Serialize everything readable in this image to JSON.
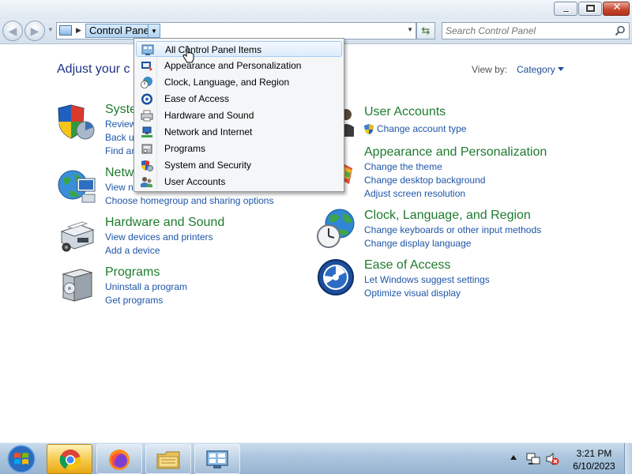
{
  "window": {
    "minimize_icon": "minimize-icon",
    "maximize_icon": "maximize-icon",
    "close_glyph": "✕"
  },
  "address_bar": {
    "breadcrumb": "Control Panel",
    "search_placeholder": "Search Control Panel"
  },
  "main": {
    "heading": "Adjust your c",
    "view_by_label": "View by:",
    "view_by_value": "Category"
  },
  "categories_left": [
    {
      "title": "Syste",
      "links": [
        "Review",
        "Back u",
        "Find an"
      ]
    },
    {
      "title": "Netw",
      "links": [
        "View n",
        "Choose homegroup and sharing options"
      ]
    },
    {
      "title": "Hardware and Sound",
      "links": [
        "View devices and printers",
        "Add a device"
      ]
    },
    {
      "title": "Programs",
      "links": [
        "Uninstall a program",
        "Get programs"
      ]
    }
  ],
  "categories_right": [
    {
      "title": "User Accounts",
      "links": [
        "Change account type"
      ]
    },
    {
      "title": "Appearance and Personalization",
      "links": [
        "Change the theme",
        "Change desktop background",
        "Adjust screen resolution"
      ]
    },
    {
      "title": "Clock, Language, and Region",
      "links": [
        "Change keyboards or other input methods",
        "Change display language"
      ]
    },
    {
      "title": "Ease of Access",
      "links": [
        "Let Windows suggest settings",
        "Optimize visual display"
      ]
    }
  ],
  "dropdown": {
    "items": [
      {
        "label": "All Control Panel Items",
        "highlighted": true
      },
      {
        "label": "Appearance and Personalization"
      },
      {
        "label": "Clock, Language, and Region"
      },
      {
        "label": "Ease of Access"
      },
      {
        "label": "Hardware and Sound"
      },
      {
        "label": "Network and Internet"
      },
      {
        "label": "Programs"
      },
      {
        "label": "System and Security"
      },
      {
        "label": "User Accounts"
      }
    ]
  },
  "taskbar": {
    "apps": [
      "chrome",
      "firefox",
      "windows-explorer",
      "control-panel"
    ],
    "active_app": "chrome",
    "time": "3:21 PM",
    "date": "6/10/2023"
  },
  "colors": {
    "category_title": "#1e7b2e",
    "link": "#1e56a7",
    "heading": "#1e3287",
    "taskbar_active": "#f5c84a"
  }
}
